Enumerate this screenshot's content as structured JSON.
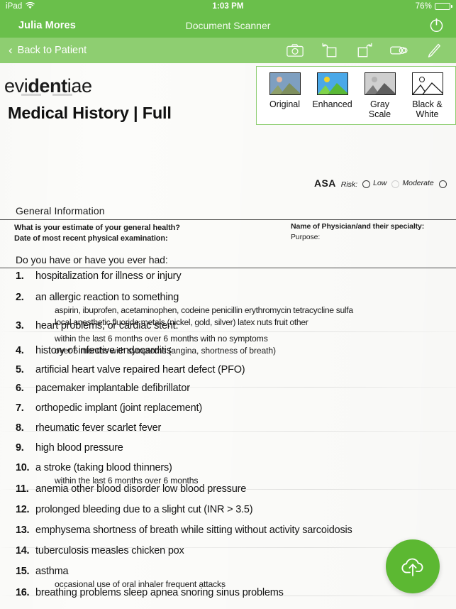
{
  "status_bar": {
    "device": "iPad",
    "wifi_icon": "wifi-icon",
    "time": "1:03 PM",
    "battery_percent": "76%",
    "battery_level": 76
  },
  "nav": {
    "user_name": "Julia Mores",
    "title": "Document Scanner",
    "power_icon": "power-icon"
  },
  "toolbar": {
    "back_label": "Back to Patient",
    "back_chevron": "‹",
    "icons": [
      {
        "name": "camera-icon",
        "label": "Camera"
      },
      {
        "name": "rotate-left-icon",
        "label": "Rotate Left"
      },
      {
        "name": "rotate-right-icon",
        "label": "Rotate Right"
      },
      {
        "name": "filter-icon",
        "label": "Filters"
      },
      {
        "name": "pencil-icon",
        "label": "Edit"
      }
    ]
  },
  "filter_panel": {
    "options": [
      {
        "label": "Original",
        "icon": "image-thumbnail-icon",
        "sky": "#7e9fc0",
        "sun": "#e8b9a0",
        "mtn1": "#8fa06b",
        "mtn2": "#7e8f5e"
      },
      {
        "label": "Enhanced",
        "icon": "image-thumbnail-icon",
        "sky": "#4aa8e8",
        "sun": "#f2d32a",
        "mtn1": "#7fd44a",
        "mtn2": "#5ab836"
      },
      {
        "label": "Gray\nScale",
        "icon": "image-thumbnail-icon",
        "sky": "#cfcfcf",
        "sun": "#b4b4b4",
        "mtn1": "#7a7a7a",
        "mtn2": "#5e5e5e"
      },
      {
        "label": "Black &\nWhite",
        "icon": "image-thumbnail-icon",
        "sky": "#ffffff",
        "sun": "#ffffff",
        "mtn1": "#ffffff",
        "mtn2": "#ffffff"
      }
    ]
  },
  "fab": {
    "name": "cloud-upload-button",
    "icon": "cloud-upload-icon",
    "color": "#5cb832"
  },
  "document": {
    "logo_pre": "evi",
    "logo_bold": "dent",
    "logo_post": "iae",
    "title": "Medical History | Full",
    "section_heading": "General Information",
    "general_questions": [
      "What is your estimate of your general health?",
      "Date of most recent physical examination:"
    ],
    "physician_fields": [
      "Name of Physician/and their specialty:",
      "Purpose:"
    ],
    "asa": {
      "label": "ASA",
      "risk_label": "Risk:",
      "option_low": "Low",
      "option_moderate": "Moderate"
    },
    "prompt": "Do you have or have you ever had:",
    "items": [
      {
        "num": "1.",
        "main": "hospitalization for illness or injury",
        "subs": []
      },
      {
        "num": "2.",
        "main": "an allergic reaction to something",
        "subs": [
          "aspirin, ibuprofen, acetaminophen, codeine   penicillin   erythromycin   tetracycline   sulfa",
          "local anesthetic   fluoride   metals (nickel, gold, silver)   latex   nuts   fruit   other"
        ]
      },
      {
        "num": "3.",
        "main": "heart problems, or cardiac stent:",
        "subs": [
          "within the last 6 months   over 6 months with no symptoms",
          "over 6 months with symptoms (angina, shortness of breath)"
        ]
      },
      {
        "num": "4.",
        "main": "history of infective endocarditis",
        "subs": []
      },
      {
        "num": "5.",
        "main": "artificial heart valve   repaired heart defect (PFO)",
        "subs": []
      },
      {
        "num": "6.",
        "main": "pacemaker   implantable defibrillator",
        "subs": []
      },
      {
        "num": "7.",
        "main": "orthopedic implant (joint replacement)",
        "subs": []
      },
      {
        "num": "8.",
        "main": "rheumatic fever   scarlet fever",
        "subs": []
      },
      {
        "num": "9.",
        "main": "high blood pressure",
        "subs": []
      },
      {
        "num": "10.",
        "main": "a stroke (taking blood thinners)",
        "subs": [
          "within the last 6 months   over 6 months"
        ]
      },
      {
        "num": "11.",
        "main": "anemia   other blood disorder   low blood pressure",
        "subs": []
      },
      {
        "num": "12.",
        "main": "prolonged bleeding due to a slight cut (INR > 3.5)",
        "subs": []
      },
      {
        "num": "13.",
        "main": "emphysema   shortness of breath while sitting without activity   sarcoidosis",
        "subs": []
      },
      {
        "num": "14.",
        "main": "tuberculosis   measles   chicken pox",
        "subs": []
      },
      {
        "num": "15.",
        "main": "asthma",
        "subs": [
          "occasional use of oral inhaler   frequent attacks"
        ]
      },
      {
        "num": "16.",
        "main": "breathing problems   sleep apnea   snoring   sinus problems",
        "subs": []
      }
    ]
  },
  "colors": {
    "brand_green": "#6abf4b",
    "toolbar_green": "#8ece71",
    "fab_green": "#5cb832",
    "panel_border": "#8ece71"
  }
}
